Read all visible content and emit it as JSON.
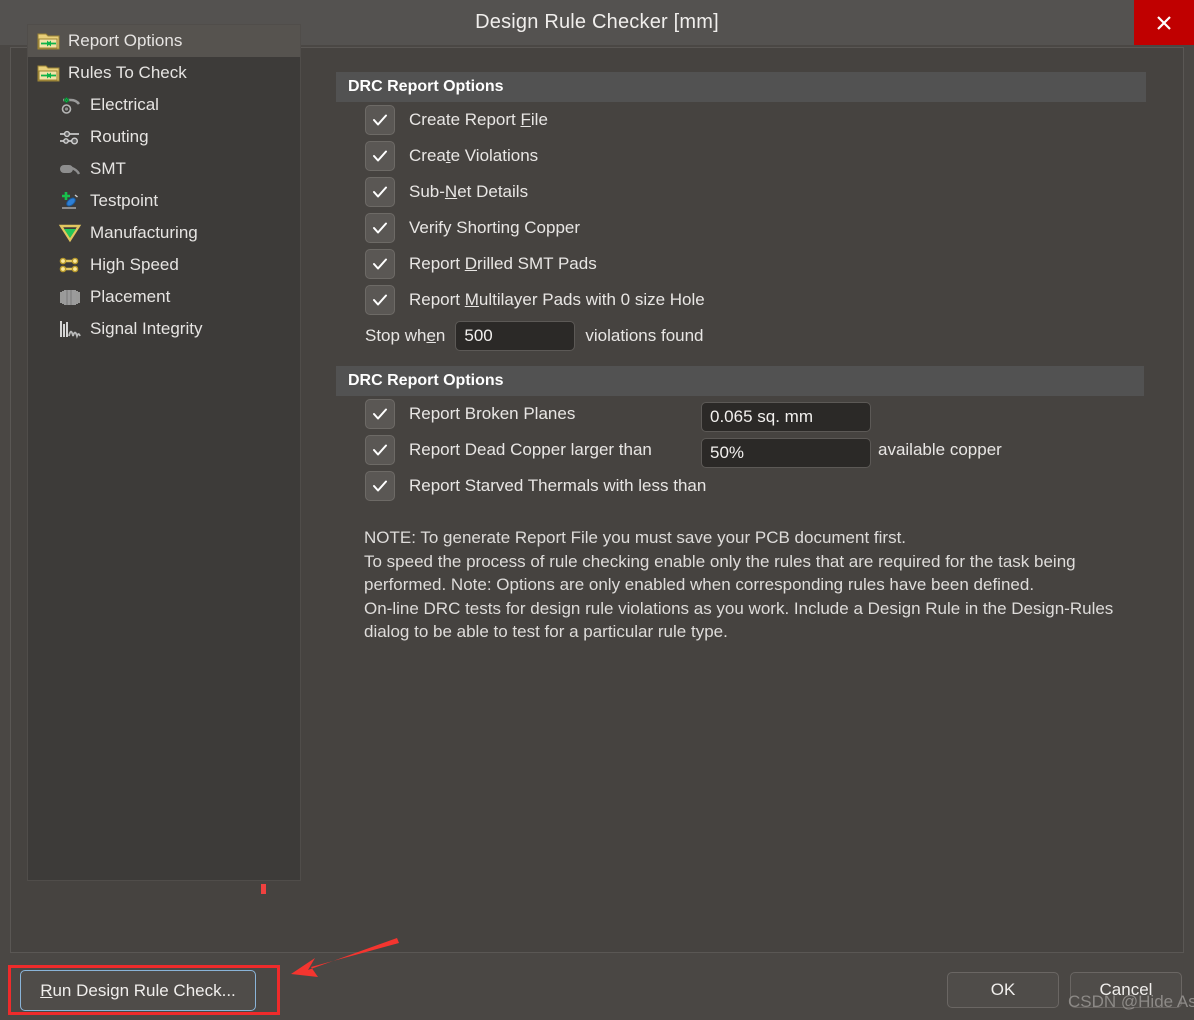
{
  "window": {
    "title": "Design Rule Checker [mm]",
    "close_icon": "close-x-icon"
  },
  "sidebar": {
    "items": [
      {
        "label": "Report Options",
        "icon": "folder-report-icon",
        "level": 0,
        "selected": true
      },
      {
        "label": "Rules To Check",
        "icon": "folder-rules-icon",
        "level": 0,
        "selected": false
      },
      {
        "label": "Electrical",
        "icon": "electrical-icon",
        "level": 1,
        "selected": false
      },
      {
        "label": "Routing",
        "icon": "routing-icon",
        "level": 1,
        "selected": false
      },
      {
        "label": "SMT",
        "icon": "smt-icon",
        "level": 1,
        "selected": false
      },
      {
        "label": "Testpoint",
        "icon": "testpoint-icon",
        "level": 1,
        "selected": false
      },
      {
        "label": "Manufacturing",
        "icon": "manufacturing-icon",
        "level": 1,
        "selected": false
      },
      {
        "label": "High Speed",
        "icon": "high-speed-icon",
        "level": 1,
        "selected": false
      },
      {
        "label": "Placement",
        "icon": "placement-icon",
        "level": 1,
        "selected": false
      },
      {
        "label": "Signal Integrity",
        "icon": "signal-integrity-icon",
        "level": 1,
        "selected": false
      }
    ]
  },
  "section1": {
    "header": "DRC Report Options",
    "options": [
      {
        "label_pre": "Create Report ",
        "accel": "F",
        "label_post": "ile",
        "checked": true
      },
      {
        "label_pre": "Crea",
        "accel": "t",
        "label_post": "e Violations",
        "checked": true
      },
      {
        "label_pre": "Sub-",
        "accel": "N",
        "label_post": "et Details",
        "checked": true
      },
      {
        "label_pre": "Verify Shorting Copper",
        "accel": "",
        "label_post": "",
        "checked": true
      },
      {
        "label_pre": "Report ",
        "accel": "D",
        "label_post": "rilled SMT Pads",
        "checked": true
      },
      {
        "label_pre": "Report ",
        "accel": "M",
        "label_post": "ultilayer Pads with 0 size Hole",
        "checked": true
      }
    ],
    "stop_when": {
      "label_pre": "Stop wh",
      "accel": "e",
      "label_post": "n",
      "value": "500",
      "suffix": "violations found"
    }
  },
  "section2": {
    "header": "DRC Report Options",
    "broken_planes": {
      "label": "Report Broken Planes",
      "checked": true
    },
    "dead_copper": {
      "label": "Report Dead Copper larger than",
      "value": "0.065 sq. mm",
      "checked": true
    },
    "starved_thermals": {
      "label": "Report Starved Thermals with less than",
      "value": "50%",
      "suffix": "available copper",
      "checked": true
    }
  },
  "note": {
    "line1": "NOTE: To generate Report File you must save your PCB document first.",
    "line2": "To speed the process of rule checking enable only the rules that are required for the task being",
    "line3": "performed.  Note: Options are only enabled when corresponding rules have been defined.",
    "line4": "On-line DRC tests for design rule violations as you work. Include a Design Rule in the Design-Rules",
    "line5": "dialog to be able to test for a particular rule  type."
  },
  "footer": {
    "run_pre": "R",
    "run_post": "un Design Rule Check...",
    "ok": "OK",
    "cancel": "Cancel"
  },
  "watermark": "CSDN @Hide Asn",
  "colors": {
    "accent_red": "#ee2b2b",
    "close_red": "#c00000",
    "focus_blue": "#8ab4d8",
    "header_gray": "#525252"
  }
}
